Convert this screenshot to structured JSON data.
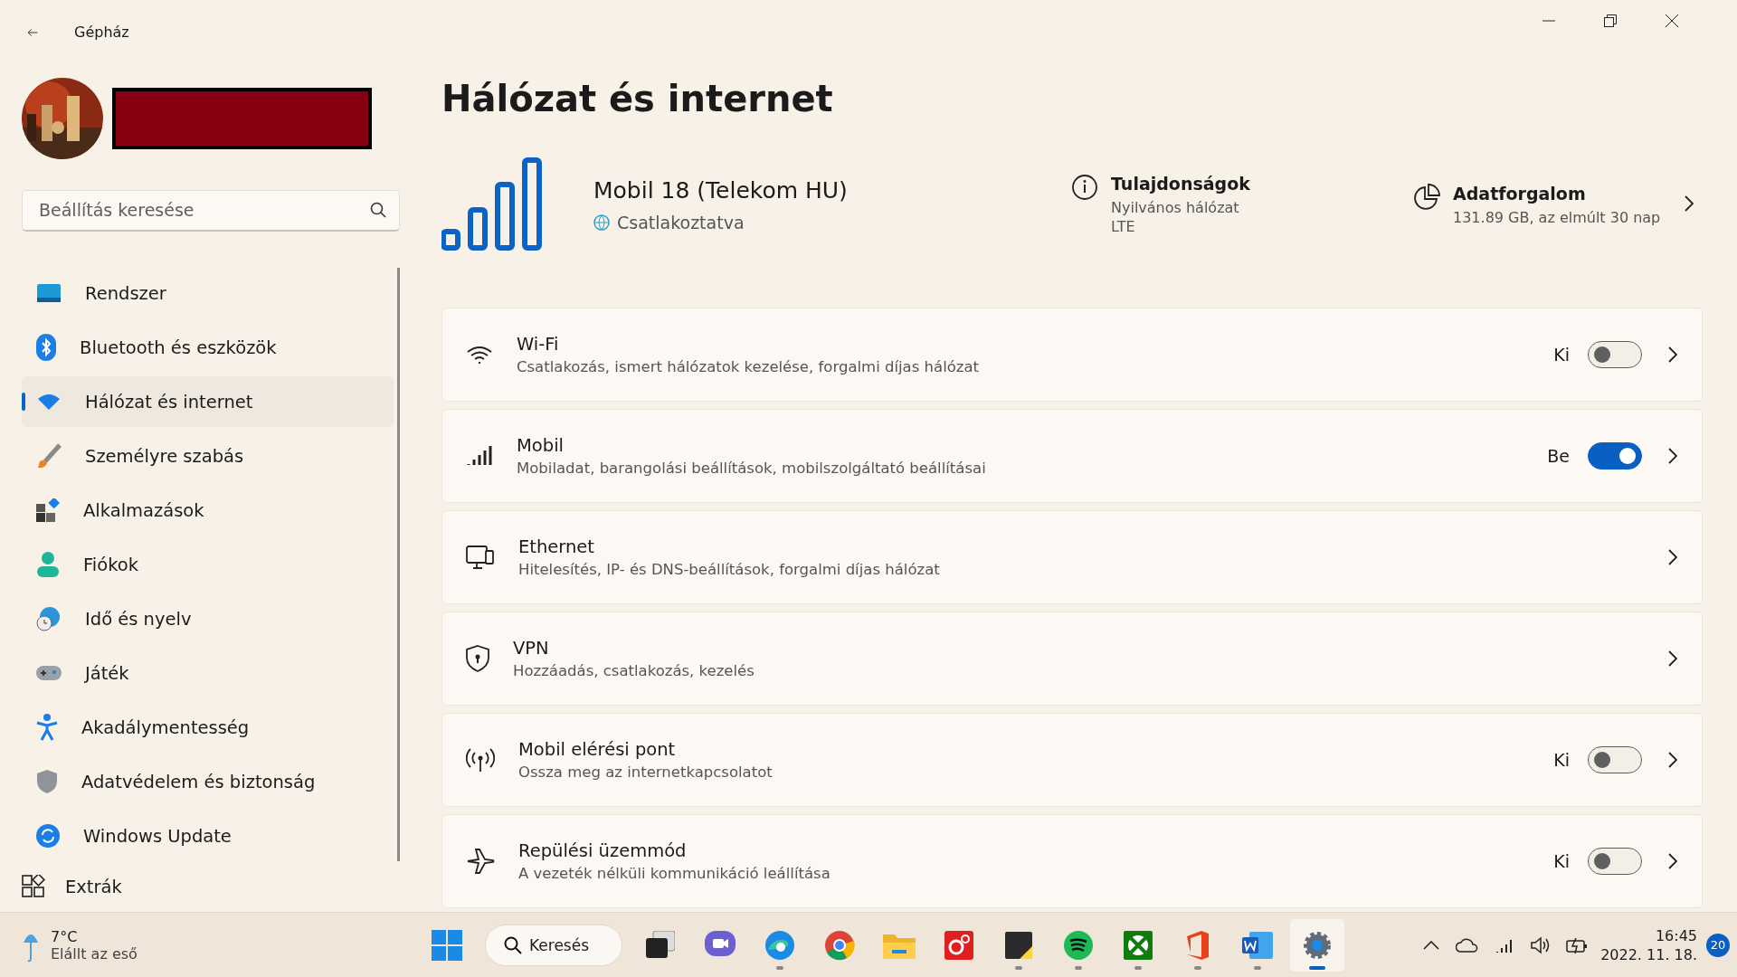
{
  "window": {
    "title": "Gépház"
  },
  "search": {
    "placeholder": "Beállítás keresése"
  },
  "sidebar": {
    "items": [
      {
        "label": "Rendszer",
        "selected": false
      },
      {
        "label": "Bluetooth és eszközök",
        "selected": false
      },
      {
        "label": "Hálózat és internet",
        "selected": true
      },
      {
        "label": "Személyre szabás",
        "selected": false
      },
      {
        "label": "Alkalmazások",
        "selected": false
      },
      {
        "label": "Fiókok",
        "selected": false
      },
      {
        "label": "Idő és nyelv",
        "selected": false
      },
      {
        "label": "Játék",
        "selected": false
      },
      {
        "label": "Akadálymentesség",
        "selected": false
      },
      {
        "label": "Adatvédelem és biztonság",
        "selected": false
      },
      {
        "label": "Windows Update",
        "selected": false
      },
      {
        "label": "Extrák",
        "selected": false
      }
    ]
  },
  "page_title": "Hálózat és internet",
  "connection": {
    "name": "Mobil 18 (Telekom HU)",
    "status": "Csatlakoztatva",
    "properties": {
      "title": "Tulajdonságok",
      "lines": [
        "Nyilvános hálózat",
        "LTE"
      ]
    },
    "usage": {
      "title": "Adatforgalom",
      "detail": "131.89 GB, az elmúlt 30 nap"
    }
  },
  "settings": [
    {
      "kind": "toggle",
      "title": "Wi-Fi",
      "description": "Csatlakozás, ismert hálózatok kezelése, forgalmi díjas hálózat",
      "on": false,
      "state_label": "Ki"
    },
    {
      "kind": "toggle",
      "title": "Mobil",
      "description": "Mobiladat, barangolási beállítások, mobilszolgáltató beállításai",
      "on": true,
      "state_label": "Be"
    },
    {
      "kind": "link",
      "title": "Ethernet",
      "description": "Hitelesítés, IP- és DNS-beállítások, forgalmi díjas hálózat"
    },
    {
      "kind": "link",
      "title": "VPN",
      "description": "Hozzáadás, csatlakozás, kezelés"
    },
    {
      "kind": "toggle",
      "title": "Mobil elérési pont",
      "description": "Ossza meg az internetkapcsolatot",
      "on": false,
      "state_label": "Ki"
    },
    {
      "kind": "toggle",
      "title": "Repülési üzemmód",
      "description": "A vezeték nélküli kommunikáció leállítása",
      "on": false,
      "state_label": "Ki"
    }
  ],
  "taskbar": {
    "weather": {
      "temperature": "7°C",
      "condition": "Elállt az eső"
    },
    "search_label": "Keresés",
    "apps": [
      {
        "running": false,
        "selected": false
      },
      {
        "running": false,
        "selected": false
      },
      {
        "running": false,
        "selected": false
      },
      {
        "running": true,
        "selected": false
      },
      {
        "running": false,
        "selected": false
      },
      {
        "running": false,
        "selected": false
      },
      {
        "running": false,
        "selected": false
      },
      {
        "running": true,
        "selected": false
      },
      {
        "running": true,
        "selected": false
      },
      {
        "running": true,
        "selected": false
      },
      {
        "running": true,
        "selected": false
      },
      {
        "running": true,
        "selected": false
      },
      {
        "running": true,
        "selected": true
      }
    ],
    "time": "16:45",
    "date": "2022. 11. 18.",
    "notifications": "20"
  }
}
